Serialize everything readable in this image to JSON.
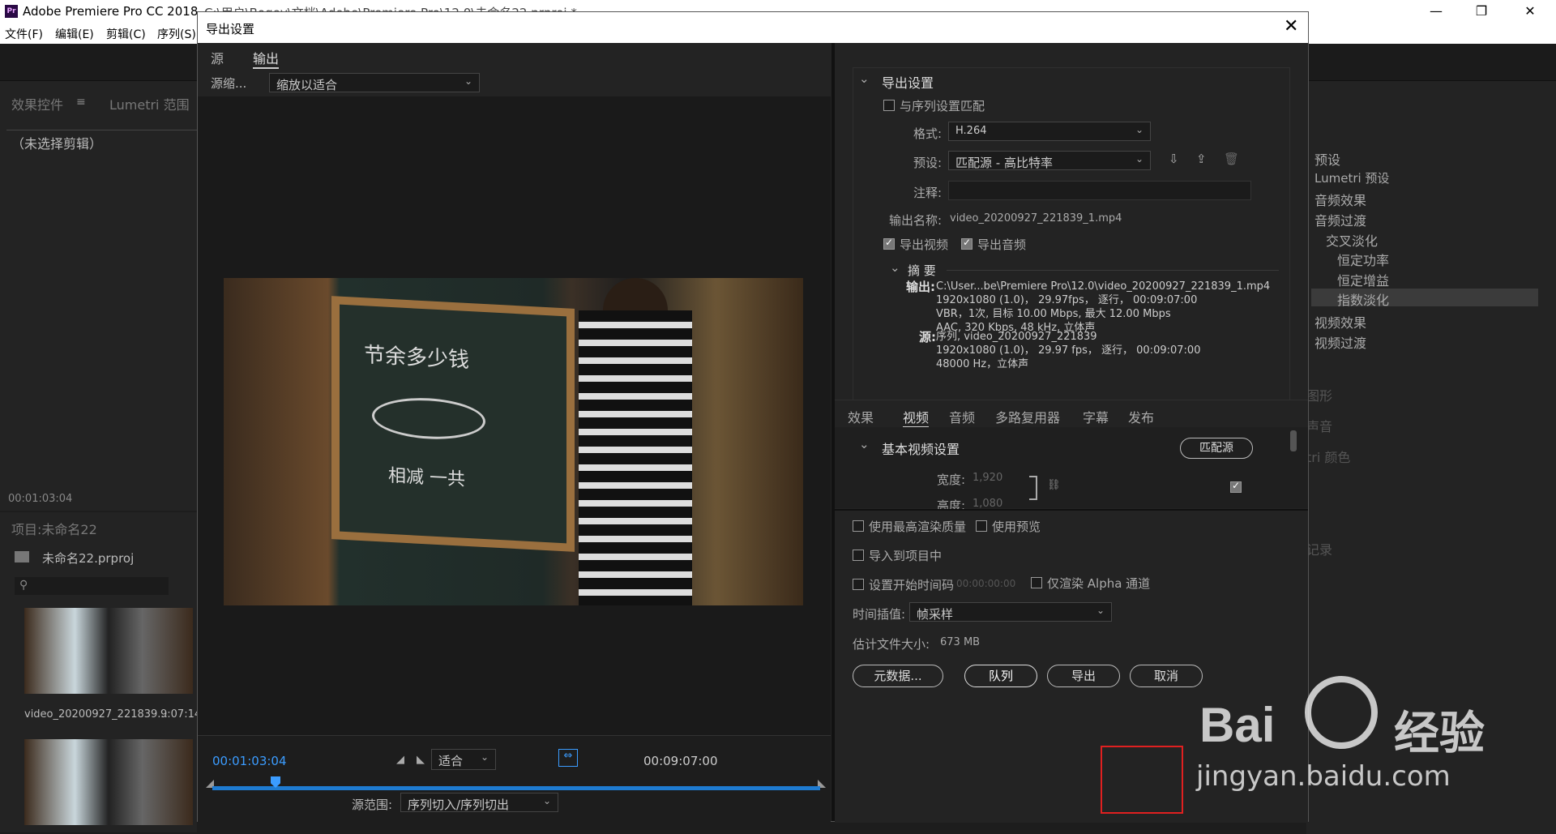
{
  "app": {
    "title": "Adobe Premiere Pro CC 2018",
    "path": "C:\\用户\\Bogey\\文档\\Adobe\\Premiere Pro\\12.0\\未命名22.prproj *",
    "menu": [
      "文件(F)",
      "编辑(E)",
      "剪辑(C)",
      "序列(S)"
    ]
  },
  "left_panel": {
    "tab_effect_controls": "效果控件",
    "tab_lumetri": "Lumetri 范围",
    "no_clip": "（未选择剪辑）",
    "timecode": "00:01:03:04"
  },
  "project": {
    "title": "项目:未命名22",
    "file": "未命名22.prproj",
    "clip_name": "video_20200927_221839...",
    "clip_duration": "9:07:14"
  },
  "effects": {
    "items": [
      "预设",
      "Lumetri 预设",
      "音频效果",
      "音频过渡",
      "交叉淡化",
      "恒定功率",
      "恒定增益",
      "指数淡化",
      "视频效果",
      "视频过渡"
    ],
    "faded": [
      "图形",
      "声音",
      "tri 颜色",
      "记录"
    ]
  },
  "dialog": {
    "title": "导出设置",
    "tab_source": "源",
    "tab_output": "输出",
    "source_scale_label": "源缩...",
    "source_scale_value": "缩放以适合",
    "chalk_line1": "节余多少钱",
    "chalk_line2": "相减  一共",
    "timecode_current": "00:01:03:04",
    "timecode_end": "00:09:07:00",
    "fit_value": "适合",
    "source_range_label": "源范围:",
    "source_range_value": "序列切入/序列切出"
  },
  "export_settings": {
    "section_title": "导出设置",
    "match_sequence": "与序列设置匹配",
    "format_label": "格式:",
    "format_value": "H.264",
    "preset_label": "预设:",
    "preset_value": "匹配源 - 高比特率",
    "comment_label": "注释:",
    "output_name_label": "输出名称:",
    "output_name_value": "video_20200927_221839_1.mp4",
    "export_video": "导出视频",
    "export_audio": "导出音频",
    "summary_title": "摘 要",
    "output_label": "输出:",
    "output_lines": [
      "C:\\User...be\\Premiere Pro\\12.0\\video_20200927_221839_1.mp4",
      "1920x1080 (1.0)， 29.97fps， 逐行， 00:09:07:00",
      "VBR，1次, 目标 10.00 Mbps, 最大 12.00 Mbps",
      "AAC, 320 Kbps, 48  kHz, 立体声"
    ],
    "source_label": "源:",
    "source_lines": [
      "序列, video_20200927_221839",
      "1920x1080 (1.0)， 29.97 fps， 逐行， 00:09:07:00",
      "48000 Hz，立体声"
    ]
  },
  "tabs": [
    "效果",
    "视频",
    "音频",
    "多路复用器",
    "字幕",
    "发布"
  ],
  "video_settings": {
    "title": "基本视频设置",
    "match_source": "匹配源",
    "width_label": "宽度:",
    "width_value": "1,920",
    "height_label": "高度:",
    "height_value": "1,080"
  },
  "bottom": {
    "max_render": "使用最高渲染质量",
    "use_preview": "使用预览",
    "import_project": "导入到项目中",
    "set_start_tc": "设置开始时间码",
    "start_tc_value": "00:00:00:00",
    "alpha_only": "仅渲染 Alpha 通道",
    "time_interp_label": "时间插值:",
    "time_interp_value": "帧采样",
    "file_size_label": "估计文件大小:",
    "file_size_value": "673 MB",
    "metadata_button": "元数据...",
    "queue_button": "队列",
    "export_button": "导出",
    "cancel_button": "取消"
  },
  "watermark": {
    "brand": "Bai",
    "brand2": "经验",
    "url": "jingyan.baidu.com"
  }
}
